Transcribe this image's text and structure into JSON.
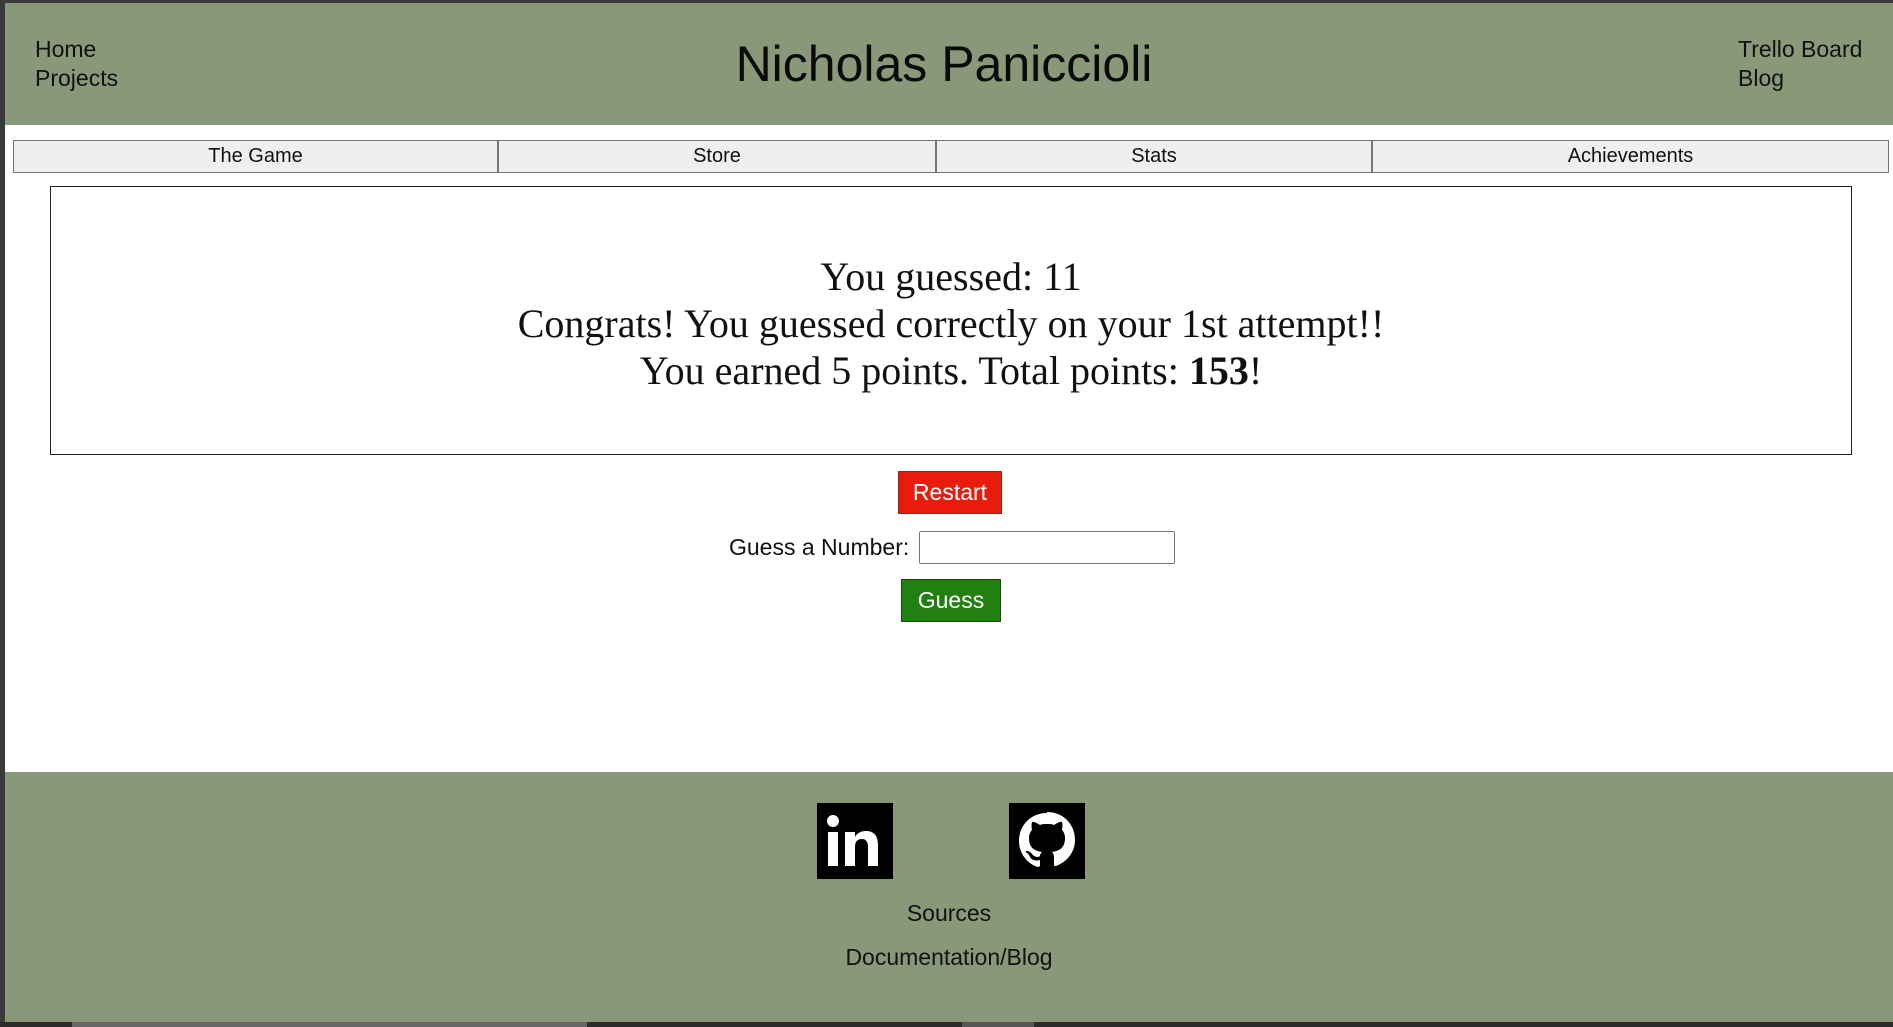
{
  "header": {
    "title": "Nicholas Paniccioli",
    "nav_left": [
      "Home",
      "Projects"
    ],
    "nav_right": [
      "Trello Board",
      "Blog"
    ]
  },
  "tabs": [
    "The Game",
    "Store",
    "Stats",
    "Achievements"
  ],
  "result": {
    "line1": "You guessed: 11",
    "line2": "Congrats! You guessed correctly on your 1st attempt!!",
    "line3_prefix": "You earned 5 points. Total points: ",
    "total_points": "153",
    "line3_suffix": "!"
  },
  "controls": {
    "restart_label": "Restart",
    "guess_label": "Guess a Number:",
    "guess_value": "",
    "guess_button_label": "Guess"
  },
  "footer": {
    "social_icons": [
      "linkedin-icon",
      "github-icon"
    ],
    "sources_label": "Sources",
    "docs_label": "Documentation/Blog"
  },
  "colors": {
    "header_bg": "#889879",
    "restart_bg": "#e81b0c",
    "guess_bg": "#228011"
  }
}
